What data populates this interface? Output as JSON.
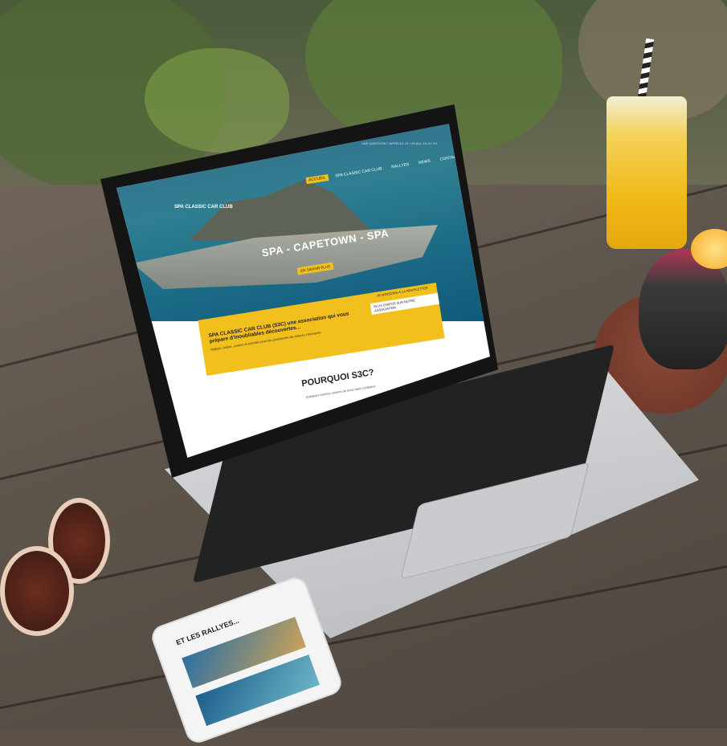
{
  "site": {
    "topbar": "UNE QUESTION ? APPELEZ LE +33 (0)1 XX XX XX",
    "logo": "SPA CLASSIC CAR CLUB",
    "nav": [
      "ACCUEIL",
      "SPA CLASSIC CAR CLUB",
      "RALLYES",
      "NEWS",
      "CONTACT"
    ],
    "hero_title": "SPA - CAPETOWN - SPA",
    "hero_button": "EN SAVOIR PLUS",
    "intro_heading": "SPA CLASSIC CAR CLUB (S3C) une association qui vous prépare d'inoubliables découvertes...",
    "intro_sub": "Rallyes, visites, soirées et activités pour les passionnés de voitures classiques.",
    "newsletter_label": "JE M'INSCRIS À LA NEWSLETTER",
    "association_button": "PLUS D'INFOS SUR NOTRE ASSOCIATION",
    "why_title": "POURQUOI S3C?",
    "why_sub": "Quelques bonnes raisons de nous faire confiance."
  },
  "phone": {
    "title": "ET LES RALLYES..."
  },
  "colors": {
    "accent": "#f2c01d",
    "sea": "#1b6a86"
  }
}
